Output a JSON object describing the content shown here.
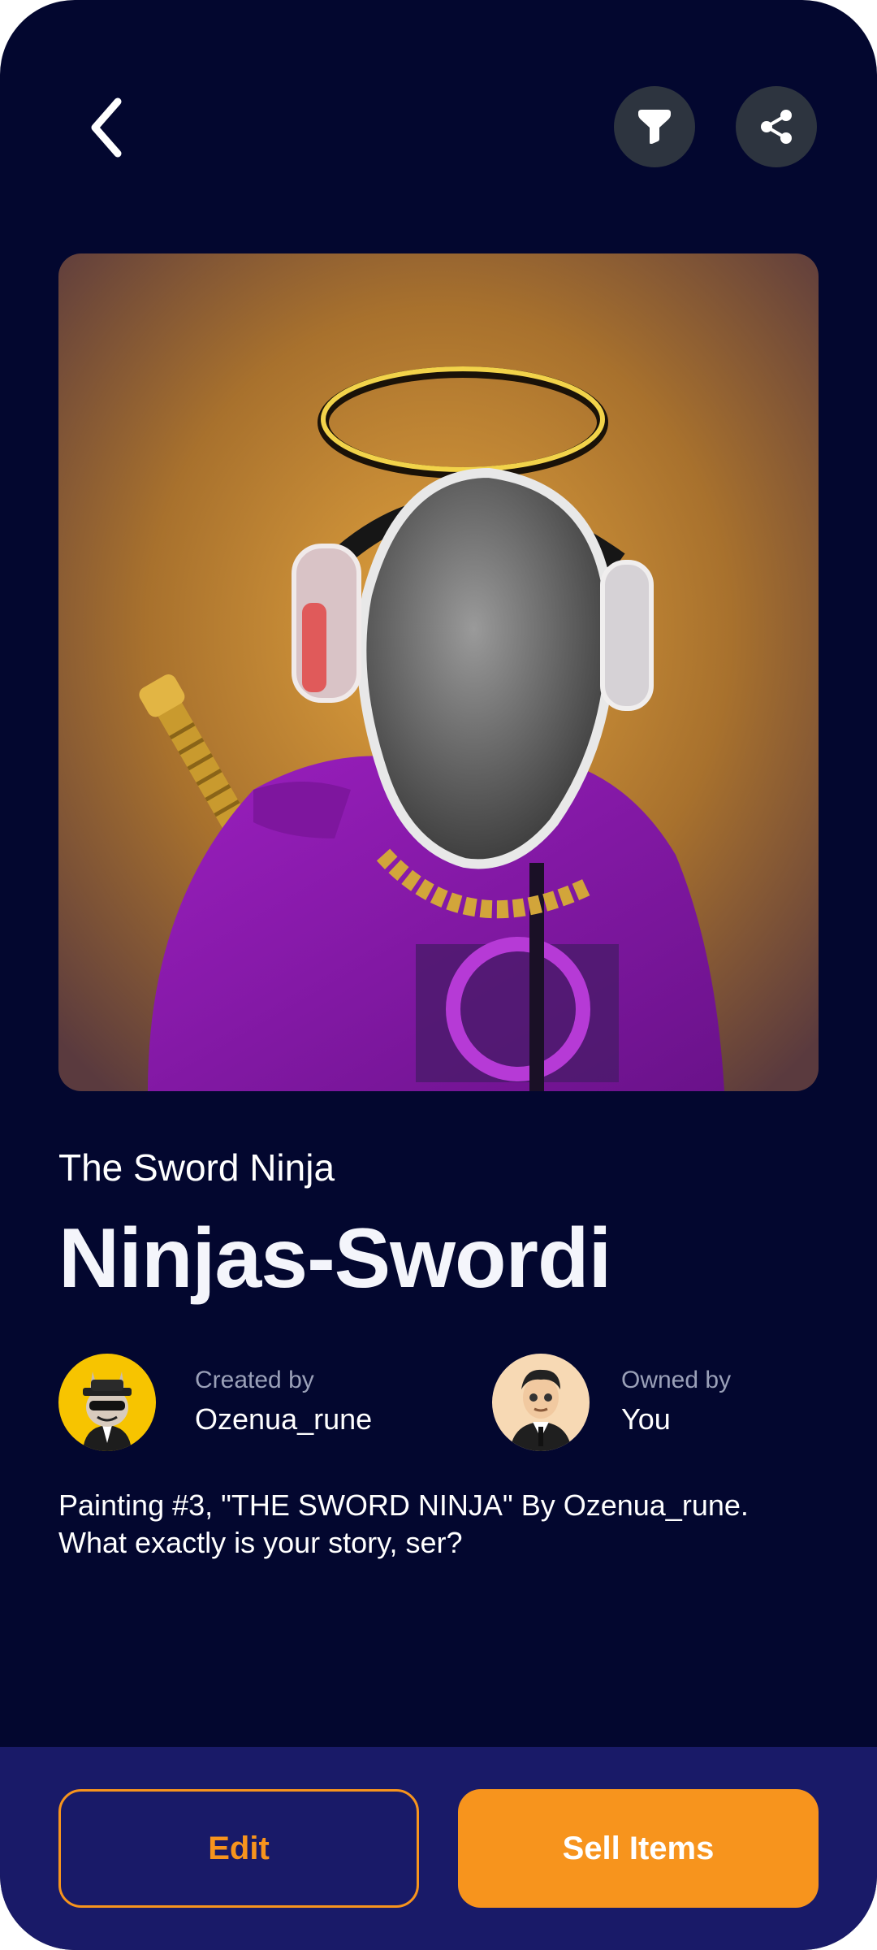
{
  "header": {
    "back_icon": "chevron-left-icon",
    "filter_icon": "filter-icon",
    "share_icon": "share-icon"
  },
  "nft": {
    "collection": "The Sword Ninja",
    "name": "Ninjas-Swordi",
    "description": "Painting #3, \"THE SWORD NINJA\" By Ozenua_rune. What exactly is your story, ser?"
  },
  "creator": {
    "label": "Created by",
    "name": "Ozenua_rune"
  },
  "owner": {
    "label": "Owned by",
    "name": "You"
  },
  "actions": {
    "edit_label": "Edit",
    "sell_label": "Sell Items"
  },
  "colors": {
    "background": "#03072f",
    "accent": "#f7941d",
    "bottom_bar": "#191a68",
    "icon_button": "#2d343f"
  }
}
